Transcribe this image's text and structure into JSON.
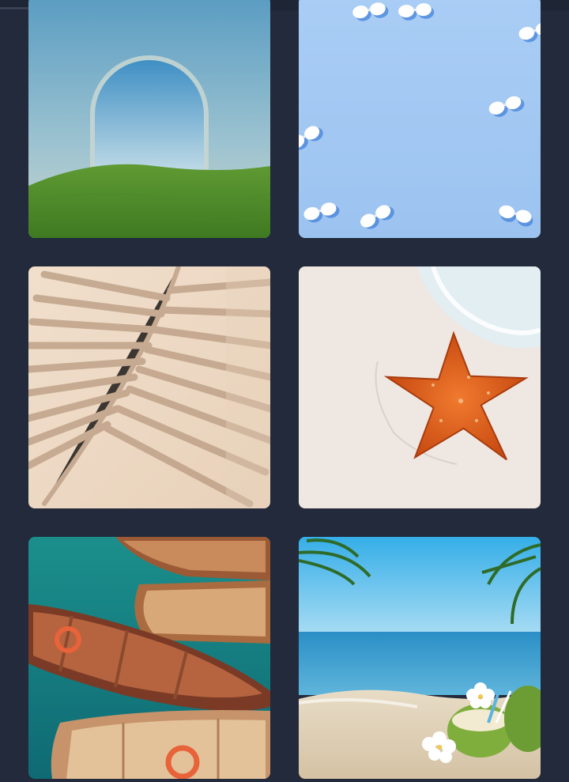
{
  "gallery": {
    "images": [
      {
        "name": "arch-on-grass-image",
        "alt": ""
      },
      {
        "name": "sunglasses-pattern-image",
        "alt": ""
      },
      {
        "name": "palm-shadow-image",
        "alt": ""
      },
      {
        "name": "starfish-on-beach-image",
        "alt": ""
      },
      {
        "name": "wooden-boats-image",
        "alt": ""
      },
      {
        "name": "coconut-drinks-beach-image",
        "alt": ""
      }
    ]
  },
  "colors": {
    "background": "#222a3b",
    "top_bar": "#1e2535",
    "progress": "#3a4255"
  }
}
